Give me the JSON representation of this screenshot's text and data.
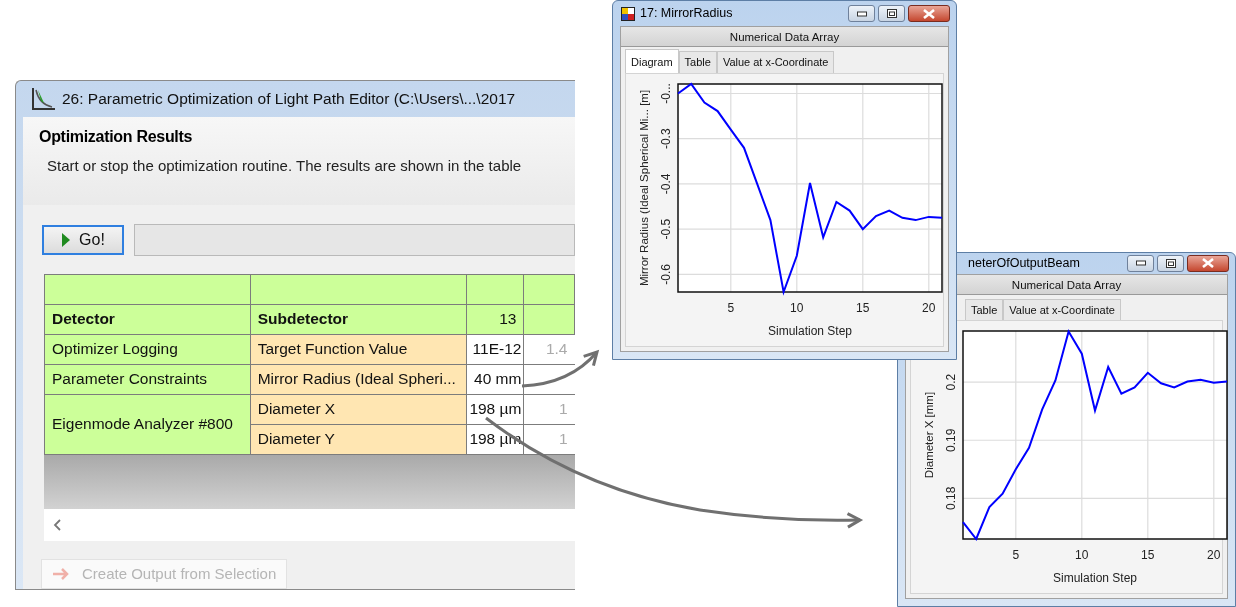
{
  "main_window": {
    "title": "26: Parametric Optimization of Light Path Editor (C:\\Users\\...\\2017",
    "heading": "Optimization Results",
    "description": "Start or stop the optimization routine. The results are shown in the table",
    "go_button": "Go!",
    "progress": {
      "level": 0
    },
    "table": {
      "columns": [
        "Detector",
        "Subdetector",
        "13"
      ],
      "detectors": [
        {
          "name": "Optimizer Logging",
          "subdetectors": [
            {
              "name": "Target Function Value",
              "column_3": "11E-12",
              "column_4": "1.4"
            }
          ]
        },
        {
          "name": "Parameter Constraints",
          "subdetectors": [
            {
              "name": "Mirror Radius (Ideal Spheri...",
              "column_3": "40 mm"
            }
          ]
        },
        {
          "name": "Eigenmode Analyzer #800",
          "subdetectors": [
            {
              "name": "Diameter X",
              "column_3": "198 µm",
              "column_4": "1"
            },
            {
              "name": "Diameter Y",
              "column_3": "198 µm",
              "column_4": "1"
            }
          ]
        }
      ]
    },
    "output_button": {
      "label": "Create Output from Selection",
      "disabled": true
    }
  },
  "windows": [
    {
      "title": "17: MirrorRadius",
      "subtitle": "Numerical Data Array",
      "tabs": [
        {
          "label": "Diagram",
          "selected": true
        },
        {
          "label": "Table",
          "selected": false
        },
        {
          "label": "Value at x-Coordinate",
          "selected": false
        }
      ],
      "chart_data": {
        "type": "line",
        "xlabel": "Simulation Step",
        "ylabel": "Mirror Radius (Ideal Spherical Mi... [m]",
        "x": [
          1,
          2,
          3,
          4,
          5,
          6,
          7,
          8,
          9,
          10,
          11,
          12,
          13,
          14,
          15,
          16,
          17,
          18,
          19,
          20,
          21
        ],
        "grid": true,
        "series": [
          {
            "color": "#0000ff",
            "values": [
              -0.2,
              -0.179,
              -0.22,
              -0.239,
              -0.28,
              -0.32,
              -0.4,
              -0.48,
              -0.639,
              -0.559,
              -0.398,
              -0.518,
              -0.44,
              -0.459,
              -0.5,
              -0.471,
              -0.459,
              -0.475,
              -0.48,
              -0.473,
              -0.475
            ]
          }
        ],
        "xlim": [
          1,
          21
        ],
        "ylim": [
          -0.639,
          -0.179
        ],
        "xticks": [
          5,
          10,
          15,
          20
        ],
        "yticks": [
          {
            "value": -0.2,
            "label": "-0..."
          },
          -0.3,
          -0.4,
          -0.5,
          -0.6
        ]
      }
    },
    {
      "title": "neterOfOutputBeam",
      "subtitle": "Numerical Data Array",
      "tabs": [
        {
          "label": "Table",
          "selected": false
        },
        {
          "label": "Value at x-Coordinate",
          "selected": false
        }
      ],
      "chart_data": {
        "type": "line",
        "xlabel": "Simulation Step",
        "ylabel": "Diameter X [mm]",
        "x": [
          1,
          2,
          3,
          4,
          5,
          6,
          7,
          8,
          9,
          10,
          11,
          12,
          13,
          14,
          15,
          16,
          17,
          18,
          19,
          20,
          21
        ],
        "grid": true,
        "series": [
          {
            "color": "#0000ff",
            "values": [
              0.1759,
              0.173,
              0.1785,
              0.1808,
              0.185,
              0.1887,
              0.1953,
              0.2003,
              0.2087,
              0.2049,
              0.1951,
              0.2026,
              0.198,
              0.1991,
              0.2016,
              0.1998,
              0.1991,
              0.2001,
              0.2004,
              0.1999,
              0.2001
            ]
          }
        ],
        "xlim": [
          1,
          21
        ],
        "ylim": [
          0.173,
          0.2088
        ],
        "xticks": [
          5,
          10,
          15,
          20
        ],
        "yticks": [
          0.18,
          0.19,
          0.2
        ]
      }
    }
  ]
}
